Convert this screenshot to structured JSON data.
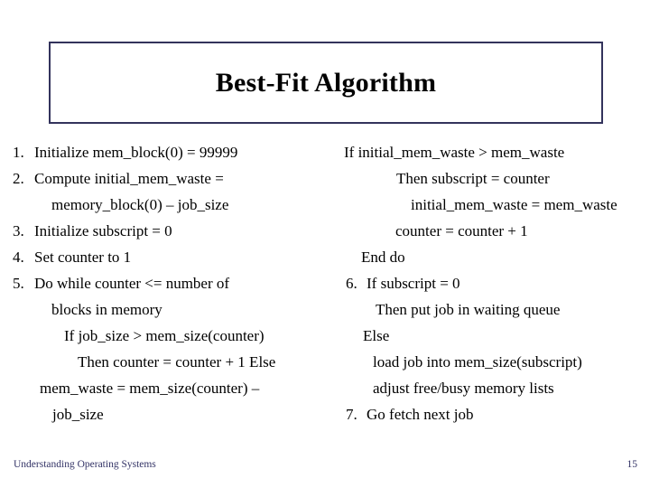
{
  "slide": {
    "title": "Best-Fit Algorithm",
    "title_border_color": "#33335c",
    "footer": "Understanding Operating Systems",
    "page_number": "15",
    "footer_color": "#333366"
  },
  "left_column": {
    "items": [
      {
        "number": "1.",
        "text": "Initialize mem_block(0) = 99999"
      },
      {
        "number": "2.",
        "text": "Compute initial_mem_waste ="
      },
      {
        "number": "",
        "text": "memory_block(0) – job_size"
      },
      {
        "number": "3.",
        "text": "Initialize subscript = 0"
      },
      {
        "number": "4.",
        "text": "Set counter to 1"
      },
      {
        "number": "5.",
        "text": "Do while counter <= number of"
      },
      {
        "number": "",
        "text": "blocks in memory"
      },
      {
        "number": "",
        "text": "If job_size > mem_size(counter)"
      },
      {
        "number": "",
        "text": "Then counter = counter + 1 Else"
      },
      {
        "number": "",
        "text": "mem_waste = mem_size(counter) –"
      },
      {
        "number": "",
        "text": "job_size"
      }
    ]
  },
  "right_column": {
    "items": [
      {
        "number": "",
        "text": "If initial_mem_waste > mem_waste"
      },
      {
        "number": "",
        "text": "Then subscript = counter"
      },
      {
        "number": "",
        "text": "initial_mem_waste = mem_waste"
      },
      {
        "number": "",
        "text": "counter = counter + 1"
      },
      {
        "number": "",
        "text": "End do"
      },
      {
        "number": "6.",
        "text": "If subscript = 0"
      },
      {
        "number": "",
        "text": "Then put job in waiting queue"
      },
      {
        "number": "",
        "text": "Else"
      },
      {
        "number": "",
        "text": "load job into mem_size(subscript)"
      },
      {
        "number": "",
        "text": "adjust free/busy memory lists"
      },
      {
        "number": "7.",
        "text": "Go fetch next job"
      }
    ]
  }
}
